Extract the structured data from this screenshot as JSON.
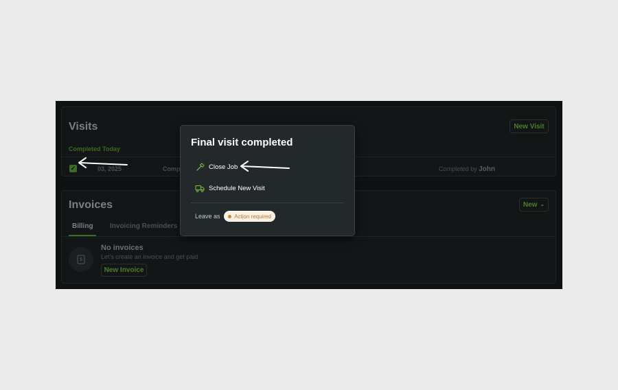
{
  "visits": {
    "title": "Visits",
    "new_visit_label": "New Visit",
    "section_label": "Completed Today",
    "row": {
      "date": "03, 2025",
      "status": "Comp",
      "completed_by_label": "Completed by",
      "completed_by_name": "John",
      "checkbox_glyph": "✓"
    }
  },
  "invoices": {
    "title": "Invoices",
    "new_label": "New",
    "new_chevron": "⌄",
    "tabs": [
      "Billing",
      "Invoicing Reminders"
    ],
    "empty": {
      "icon_glyph": "$",
      "heading": "No invoices",
      "subtext": "Let's create an invoice and get paid",
      "button": "New Invoice"
    }
  },
  "popover": {
    "title": "Final visit completed",
    "items": [
      {
        "label": "Close Job",
        "icon": "hammer-icon"
      },
      {
        "label": "Schedule New Visit",
        "icon": "truck-icon"
      }
    ],
    "leave_as_label": "Leave as",
    "badge_label": "Action required"
  },
  "colors": {
    "accent_green": "#6fae3c",
    "badge_bg": "#faf2e6",
    "badge_text": "#c0702a",
    "popover_bg": "#23282a"
  }
}
